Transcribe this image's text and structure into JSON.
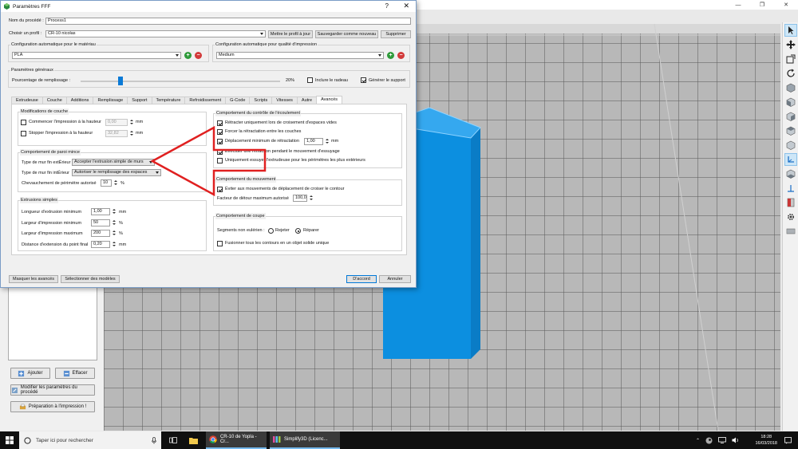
{
  "app": {
    "window_controls": [
      "—",
      "❐",
      "✕"
    ]
  },
  "dialog": {
    "title": "Paramètres FFF",
    "help_label": "?",
    "close_label": "✕",
    "process_name_label": "Nom du procédé :",
    "process_name_value": "Process1",
    "profile_label": "Choisir un profil :",
    "profile_value": "CR-10 nicolas",
    "update_profile_label": "Mettre le profil à jour",
    "save_as_new_label": "Sauvegarder comme nouveau",
    "delete_label": "Supprimer",
    "material_config_label": "Configuration automatique pour le matériau",
    "material_value": "PLA",
    "quality_config_label": "Configuration automatique pour qualité d'impression",
    "quality_value": "Medium",
    "add_symbol": "+",
    "remove_symbol": "−",
    "general_params_label": "Paramètres généraux",
    "infill_label": "Pourcentage de remplissage :",
    "infill_value": "20%",
    "infill_fraction": 0.2,
    "include_raft_label": "Inclure le radeau",
    "include_raft_checked": false,
    "generate_support_label": "Générer le support",
    "generate_support_checked": true,
    "tabs": [
      {
        "label": "Extrudeuse"
      },
      {
        "label": "Couche"
      },
      {
        "label": "Additions"
      },
      {
        "label": "Remplissage"
      },
      {
        "label": "Support"
      },
      {
        "label": "Température"
      },
      {
        "label": "Refroidissement"
      },
      {
        "label": "G-Code"
      },
      {
        "label": "Scripts"
      },
      {
        "label": "Vitesses"
      },
      {
        "label": "Autre"
      },
      {
        "label": "Avancés",
        "active": true
      }
    ],
    "layer_mods": {
      "title": "Modifications de couche",
      "start_label": "Commencer l'impression à la hauteur",
      "start_value": "0,00",
      "stop_label": "Stopper  l'impression à la hauteur",
      "stop_value": "32,82",
      "unit": "mm"
    },
    "thin_wall": {
      "title": "Comportement de paroi mince",
      "outer_label": "Type de mur fin extÉrieur",
      "outer_value": "Accepter l'extrusion simple de murs",
      "inner_label": "Type de mur fin intÉrieur",
      "inner_value": "Autoriser le remplissage des espaces",
      "overlap_label": "Chevauchement de périmètre autorisé",
      "overlap_value": "10",
      "overlap_unit": "%"
    },
    "single_ext": {
      "title": "Extrusions simples",
      "min_length_label": "Longueur d'extrusion minimum",
      "min_length_value": "1,00",
      "min_length_unit": "mm",
      "min_width_label": "Largeur d'impression minimum",
      "min_width_value": "50",
      "min_width_unit": "%",
      "max_width_label": "Largeur d'impression maximum",
      "max_width_value": "200",
      "max_width_unit": "%",
      "endpoint_label": "Distance d'extension du point final",
      "endpoint_value": "0,20",
      "endpoint_unit": "mm"
    },
    "flow": {
      "title": "Comportement du contrôle de l'écoulement",
      "retract_crossing_label": "Rétracter uniquement lors de croisement d'espaces vides",
      "force_retract_label": "Forcer la rétractation entre les couches",
      "min_move_label": "Déplacement minimum de rétractation",
      "min_move_value": "1,00",
      "min_move_unit": "mm",
      "wipe_label": "Effectuer une rétraction pendant le mouvement d'essuyage",
      "wipe_outer_label": "Uniquement essuyer l'extrudeuse pour les périmètres les plus extérieurs"
    },
    "movement": {
      "title": "Comportement du mouvement",
      "avoid_label": "Éviter aux mouvements de déplacement de croiser le contour",
      "detour_label": "Facteur de détour maximum autorisé",
      "detour_value": "100,0"
    },
    "cut": {
      "title": "Comportement de coupe",
      "non_manifold_label": "Segments non eulérien :",
      "reject_label": "Rejeter",
      "repair_label": "Réparer",
      "merge_label": "Fusionner tous les contours en un objet solide unique"
    },
    "hide_advanced_label": "Masquer les avancés",
    "select_models_label": "Sélectionner des modèles",
    "ok_label": "D'accord",
    "cancel_label": "Annuler"
  },
  "left_panel": {
    "add_label": "Ajouter",
    "remove_label": "Effacer",
    "edit_process_label": "Modifier les paramètres du procédé",
    "prepare_print_label": "Préparation à l'impression !"
  },
  "taskbar": {
    "search_placeholder": "Taper ici pour rechercher",
    "items": [
      {
        "label": "CR-10 de Yopla - Cr..."
      },
      {
        "label": "Simplify3D (Licenc..."
      }
    ],
    "time": "18:28",
    "date": "16/03/2018"
  },
  "colors": {
    "model_front": "#0c8fe0",
    "model_side": "#0a7cc6",
    "model_top": "#35a8ef",
    "annotation": "#e02020",
    "accent": "#0078d7"
  }
}
